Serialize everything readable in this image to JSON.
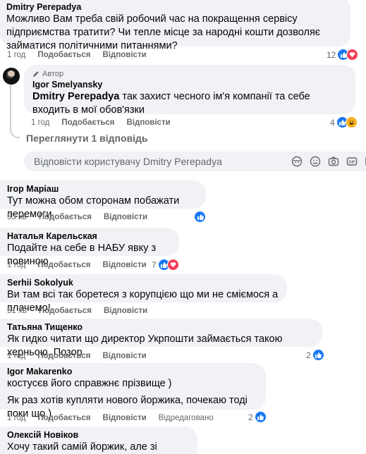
{
  "comments": [
    {
      "author": "Dmitry Perepadya",
      "text": "Можливо Вам треба свій робочий час на покращення сервісу підприємства тратити? Чи тепле місце за народні кошти дозволяє займатися політичними питаннями?",
      "time": "1 год",
      "like_label": "Подобається",
      "reply_label": "Відповісти",
      "reactions": "12"
    },
    {
      "badge": "Автор",
      "author": "Igor Smelyansky",
      "mention": "Dmitry Perepadya",
      "text": " так захист чесного ім'я компанії та себе входить в мої обов'язки",
      "time": "1 год",
      "like_label": "Подобається",
      "reply_label": "Відповісти",
      "reactions": "4"
    },
    {
      "author": "Ігор Маріаш",
      "text": "Тут можна обом сторонам побажати перемоги",
      "time": "53 хв",
      "like_label": "Подобається",
      "reply_label": "Відповісти"
    },
    {
      "author": "Наталья Карельская",
      "text": "Подайте на себе в НАБУ явку з повиною",
      "time": "1 год",
      "like_label": "Подобається",
      "reply_label": "Відповісти",
      "reactions": "7"
    },
    {
      "author": "Serhii Sokolyuk",
      "text": "Ви там всі так боретеся з корупцією що ми не смiємося а плачемо!",
      "time": "51 хв",
      "like_label": "Подобається",
      "reply_label": "Відповісти"
    },
    {
      "author": "Татьяна Тищенко",
      "text": "Як гидко читати що директор Укрпошти займається такою херньою. Позор .",
      "time": "1 год",
      "like_label": "Подобається",
      "reply_label": "Відповісти",
      "reactions": "2"
    },
    {
      "author": "Igor Makarenko",
      "text": "костусєв його справжнє прізвище )",
      "text2": "Як раз хотів купляти нового йоржика, почекаю тоді поки що )",
      "time": "1 год",
      "like_label": "Подобається",
      "reply_label": "Відповісти",
      "edited_label": "Відредаговано",
      "reactions": "2"
    },
    {
      "author": "Олексій Новіков",
      "text": "Хочу такий самій йоржик, але зі смілянським"
    }
  ],
  "view_replies": "Переглянути 1 відповідь",
  "reply_box": {
    "placeholder": "Відповісти користувачу Dmitry Perepadya"
  },
  "colors": {
    "bubble": "#f0f2f5",
    "meta": "#65676b",
    "like": "#1877f2",
    "love": "#f33e58",
    "haha": "#f7b125"
  }
}
